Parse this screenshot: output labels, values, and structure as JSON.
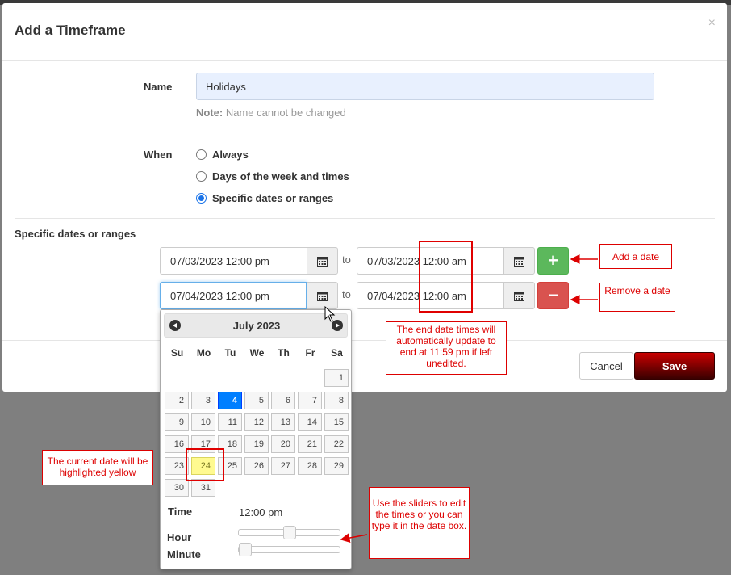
{
  "modal": {
    "title": "Add a Timeframe",
    "close_glyph": "×"
  },
  "form": {
    "name_label": "Name",
    "name_value": "Holidays",
    "note_prefix": "Note:",
    "note_text": "Name cannot be changed",
    "when_label": "When",
    "options": [
      {
        "label": "Always",
        "checked": false
      },
      {
        "label": "Days of the week and times",
        "checked": false
      },
      {
        "label": "Specific dates or ranges",
        "checked": true
      }
    ],
    "ranges_label": "Specific dates or ranges",
    "ranges": [
      {
        "start": "07/03/2023 12:00 pm",
        "to": "to",
        "end": "07/03/2023 12:00 am",
        "action": "+"
      },
      {
        "start": "07/04/2023 12:00 pm",
        "to": "to",
        "end": "07/04/2023 12:00 am",
        "action": "−"
      }
    ]
  },
  "footer": {
    "cancel_label": "Cancel",
    "save_label": "Save"
  },
  "datepicker": {
    "month_title": "July 2023",
    "days_of_week": [
      "Su",
      "Mo",
      "Tu",
      "We",
      "Th",
      "Fr",
      "Sa"
    ],
    "days": [
      "1",
      "2",
      "3",
      "4",
      "5",
      "6",
      "7",
      "8",
      "9",
      "10",
      "11",
      "12",
      "13",
      "14",
      "15",
      "16",
      "17",
      "18",
      "19",
      "20",
      "21",
      "22",
      "23",
      "24",
      "25",
      "26",
      "27",
      "28",
      "29",
      "30",
      "31"
    ],
    "selected_day": "4",
    "today_day": "24",
    "time_label": "Time",
    "time_value": "12:00 pm",
    "hour_label": "Hour",
    "minute_label": "Minute",
    "hour_fraction": 0.5,
    "minute_fraction": 0.0
  },
  "annotations": {
    "add_date": "Add a date",
    "remove_date": "Remove a date",
    "end_date": "The end date times will automatically update to end at 11:59 pm if left unedited.",
    "current_date": "The current date will be highlighted yellow",
    "sliders": "Use the sliders to edit the times or you can type it in the date box."
  },
  "colors": {
    "add": "#5cb85c",
    "remove": "#d9534f",
    "selected_day": "#007fff",
    "today_day": "#fffa90",
    "annotation": "#dd0000"
  }
}
